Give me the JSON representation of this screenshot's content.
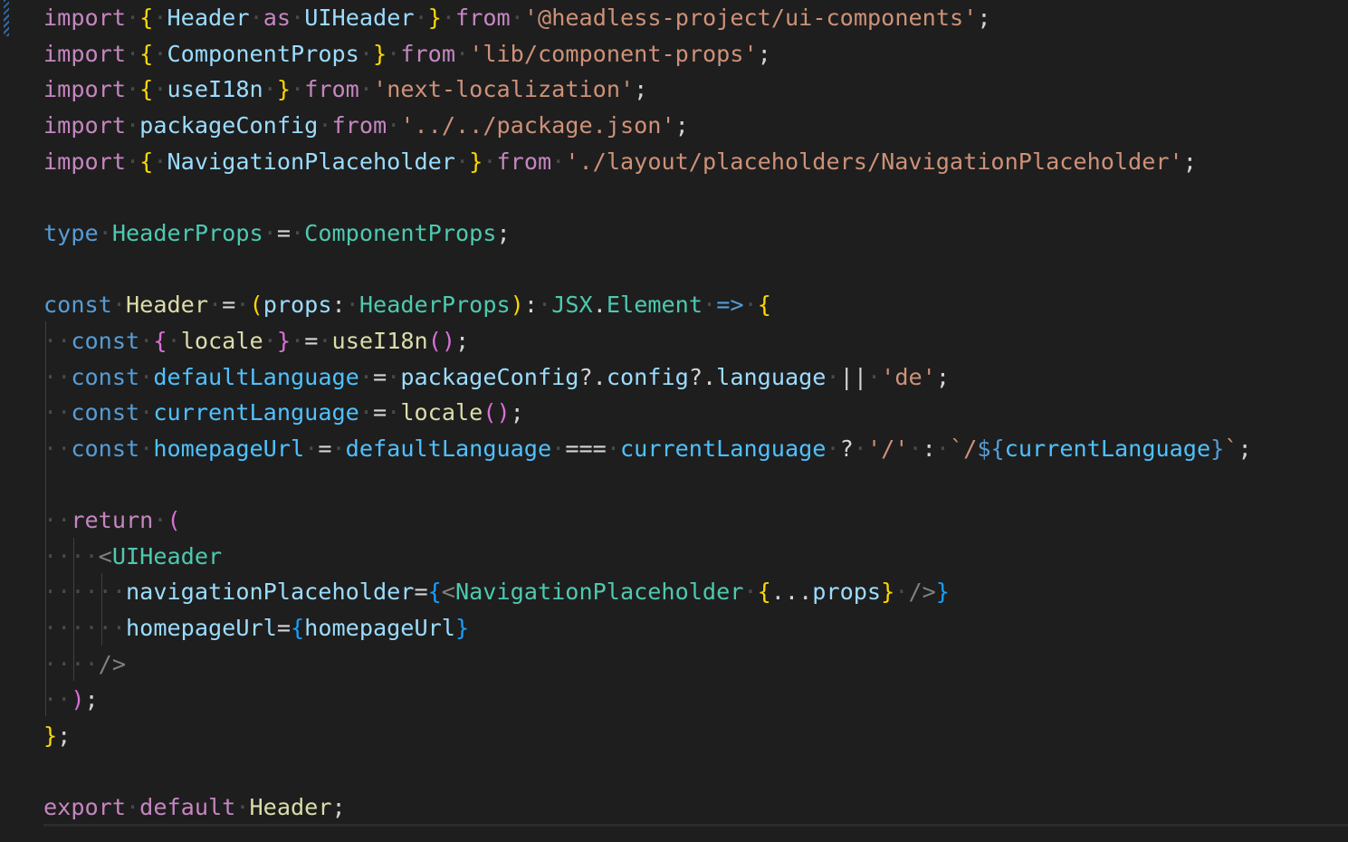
{
  "editor": {
    "language": "tsx",
    "theme": "dark",
    "lines": [
      [
        [
          "kw",
          "import"
        ],
        [
          "ws",
          "·"
        ],
        [
          "b1",
          "{"
        ],
        [
          "ws",
          "·"
        ],
        [
          "va",
          "Header"
        ],
        [
          "ws",
          "·"
        ],
        [
          "kw",
          "as"
        ],
        [
          "ws",
          "·"
        ],
        [
          "va",
          "UIHeader"
        ],
        [
          "ws",
          "·"
        ],
        [
          "b1",
          "}"
        ],
        [
          "ws",
          "·"
        ],
        [
          "kw",
          "from"
        ],
        [
          "ws",
          "·"
        ],
        [
          "sr",
          "'@headless-project/ui-components'"
        ],
        [
          "pu",
          ";"
        ]
      ],
      [
        [
          "kw",
          "import"
        ],
        [
          "ws",
          "·"
        ],
        [
          "b1",
          "{"
        ],
        [
          "ws",
          "·"
        ],
        [
          "va",
          "ComponentProps"
        ],
        [
          "ws",
          "·"
        ],
        [
          "b1",
          "}"
        ],
        [
          "ws",
          "·"
        ],
        [
          "kw",
          "from"
        ],
        [
          "ws",
          "·"
        ],
        [
          "sr",
          "'lib/component-props'"
        ],
        [
          "pu",
          ";"
        ]
      ],
      [
        [
          "kw",
          "import"
        ],
        [
          "ws",
          "·"
        ],
        [
          "b1",
          "{"
        ],
        [
          "ws",
          "·"
        ],
        [
          "va",
          "useI18n"
        ],
        [
          "ws",
          "·"
        ],
        [
          "b1",
          "}"
        ],
        [
          "ws",
          "·"
        ],
        [
          "kw",
          "from"
        ],
        [
          "ws",
          "·"
        ],
        [
          "sr",
          "'next-localization'"
        ],
        [
          "pu",
          ";"
        ]
      ],
      [
        [
          "kw",
          "import"
        ],
        [
          "ws",
          "·"
        ],
        [
          "va",
          "packageConfig"
        ],
        [
          "ws",
          "·"
        ],
        [
          "kw",
          "from"
        ],
        [
          "ws",
          "·"
        ],
        [
          "sr",
          "'../../package.json'"
        ],
        [
          "pu",
          ";"
        ]
      ],
      [
        [
          "kw",
          "import"
        ],
        [
          "ws",
          "·"
        ],
        [
          "b1",
          "{"
        ],
        [
          "ws",
          "·"
        ],
        [
          "va",
          "NavigationPlaceholder"
        ],
        [
          "ws",
          "·"
        ],
        [
          "b1",
          "}"
        ],
        [
          "ws",
          "·"
        ],
        [
          "kw",
          "from"
        ],
        [
          "ws",
          "·"
        ],
        [
          "sr",
          "'./layout/placeholders/NavigationPlaceholder'"
        ],
        [
          "pu",
          ";"
        ]
      ],
      [],
      [
        [
          "st",
          "type"
        ],
        [
          "ws",
          "·"
        ],
        [
          "ty",
          "HeaderProps"
        ],
        [
          "ws",
          "·"
        ],
        [
          "pu",
          "="
        ],
        [
          "ws",
          "·"
        ],
        [
          "ty",
          "ComponentProps"
        ],
        [
          "pu",
          ";"
        ]
      ],
      [],
      [
        [
          "st",
          "const"
        ],
        [
          "ws",
          "·"
        ],
        [
          "fn",
          "Header"
        ],
        [
          "ws",
          "·"
        ],
        [
          "pu",
          "="
        ],
        [
          "ws",
          "·"
        ],
        [
          "b1",
          "("
        ],
        [
          "va",
          "props"
        ],
        [
          "pu",
          ":"
        ],
        [
          "ws",
          "·"
        ],
        [
          "ty",
          "HeaderProps"
        ],
        [
          "b1",
          ")"
        ],
        [
          "pu",
          ":"
        ],
        [
          "ws",
          "·"
        ],
        [
          "ty",
          "JSX"
        ],
        [
          "pu",
          "."
        ],
        [
          "ty",
          "Element"
        ],
        [
          "ws",
          "·"
        ],
        [
          "st",
          "=>"
        ],
        [
          "ws",
          "·"
        ],
        [
          "b1",
          "{"
        ]
      ],
      [
        [
          "ws",
          "··"
        ],
        [
          "st",
          "const"
        ],
        [
          "ws",
          "·"
        ],
        [
          "b2",
          "{"
        ],
        [
          "ws",
          "·"
        ],
        [
          "fn",
          "locale"
        ],
        [
          "ws",
          "·"
        ],
        [
          "b2",
          "}"
        ],
        [
          "ws",
          "·"
        ],
        [
          "pu",
          "="
        ],
        [
          "ws",
          "·"
        ],
        [
          "fn",
          "useI18n"
        ],
        [
          "b2",
          "()"
        ],
        [
          "pu",
          ";"
        ]
      ],
      [
        [
          "ws",
          "··"
        ],
        [
          "st",
          "const"
        ],
        [
          "ws",
          "·"
        ],
        [
          "cn",
          "defaultLanguage"
        ],
        [
          "ws",
          "·"
        ],
        [
          "pu",
          "="
        ],
        [
          "ws",
          "·"
        ],
        [
          "va",
          "packageConfig"
        ],
        [
          "pu",
          "?."
        ],
        [
          "va",
          "config"
        ],
        [
          "pu",
          "?."
        ],
        [
          "va",
          "language"
        ],
        [
          "ws",
          "·"
        ],
        [
          "pu",
          "||"
        ],
        [
          "ws",
          "·"
        ],
        [
          "sr",
          "'de'"
        ],
        [
          "pu",
          ";"
        ]
      ],
      [
        [
          "ws",
          "··"
        ],
        [
          "st",
          "const"
        ],
        [
          "ws",
          "·"
        ],
        [
          "cn",
          "currentLanguage"
        ],
        [
          "ws",
          "·"
        ],
        [
          "pu",
          "="
        ],
        [
          "ws",
          "·"
        ],
        [
          "fn",
          "locale"
        ],
        [
          "b2",
          "()"
        ],
        [
          "pu",
          ";"
        ]
      ],
      [
        [
          "ws",
          "··"
        ],
        [
          "st",
          "const"
        ],
        [
          "ws",
          "·"
        ],
        [
          "cn",
          "homepageUrl"
        ],
        [
          "ws",
          "·"
        ],
        [
          "pu",
          "="
        ],
        [
          "ws",
          "·"
        ],
        [
          "cn",
          "defaultLanguage"
        ],
        [
          "ws",
          "·"
        ],
        [
          "pu",
          "==="
        ],
        [
          "ws",
          "·"
        ],
        [
          "cn",
          "currentLanguage"
        ],
        [
          "ws",
          "·"
        ],
        [
          "pu",
          "?"
        ],
        [
          "ws",
          "·"
        ],
        [
          "sr",
          "'/'"
        ],
        [
          "ws",
          "·"
        ],
        [
          "pu",
          ":"
        ],
        [
          "ws",
          "·"
        ],
        [
          "sr",
          "`/"
        ],
        [
          "st",
          "${"
        ],
        [
          "cn",
          "currentLanguage"
        ],
        [
          "st",
          "}"
        ],
        [
          "sr",
          "`"
        ],
        [
          "pu",
          ";"
        ]
      ],
      [],
      [
        [
          "ws",
          "··"
        ],
        [
          "kw",
          "return"
        ],
        [
          "ws",
          "·"
        ],
        [
          "b2",
          "("
        ]
      ],
      [
        [
          "ws",
          "····"
        ],
        [
          "tg",
          "<"
        ],
        [
          "ty",
          "UIHeader"
        ]
      ],
      [
        [
          "ws",
          "······"
        ],
        [
          "va",
          "navigationPlaceholder"
        ],
        [
          "pu",
          "="
        ],
        [
          "b3",
          "{"
        ],
        [
          "tg",
          "<"
        ],
        [
          "ty",
          "NavigationPlaceholder"
        ],
        [
          "ws",
          "·"
        ],
        [
          "b1",
          "{"
        ],
        [
          "pu",
          "..."
        ],
        [
          "va",
          "props"
        ],
        [
          "b1",
          "}"
        ],
        [
          "ws",
          "·"
        ],
        [
          "tg",
          "/>"
        ],
        [
          "b3",
          "}"
        ]
      ],
      [
        [
          "ws",
          "······"
        ],
        [
          "va",
          "homepageUrl"
        ],
        [
          "pu",
          "="
        ],
        [
          "b3",
          "{"
        ],
        [
          "va",
          "homepageUrl"
        ],
        [
          "b3",
          "}"
        ]
      ],
      [
        [
          "ws",
          "····"
        ],
        [
          "tg",
          "/>"
        ]
      ],
      [
        [
          "ws",
          "··"
        ],
        [
          "b2",
          ")"
        ],
        [
          "pu",
          ";"
        ]
      ],
      [
        [
          "b1",
          "}"
        ],
        [
          "pu",
          ";"
        ]
      ],
      [],
      [
        [
          "kw",
          "export"
        ],
        [
          "ws",
          "·"
        ],
        [
          "kw",
          "default"
        ],
        [
          "ws",
          "·"
        ],
        [
          "fn",
          "Header"
        ],
        [
          "pu",
          ";"
        ]
      ]
    ]
  }
}
